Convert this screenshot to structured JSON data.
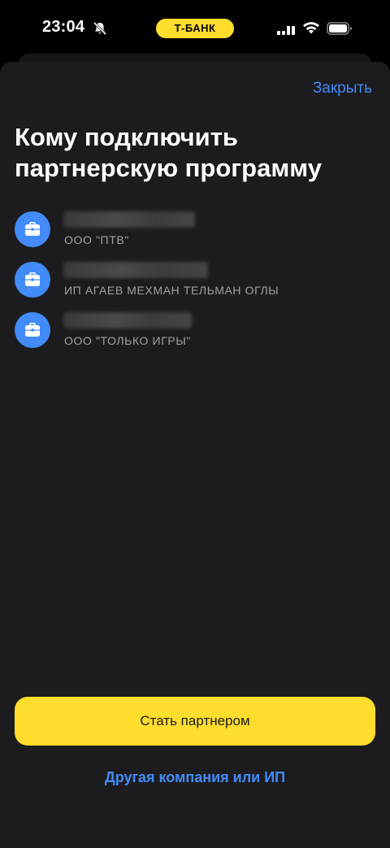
{
  "status_bar": {
    "time": "23:04",
    "pill_label": "Т-БАНК",
    "icons": [
      "bell-slash-icon",
      "cellular-signal-icon",
      "wifi-icon",
      "battery-icon"
    ]
  },
  "header": {
    "close_label": "Закрыть"
  },
  "title": "Кому подключить партнерскую программу",
  "accounts": [
    {
      "icon": "briefcase-icon",
      "name": "",
      "subtitle": "ООО \"ПТВ\""
    },
    {
      "icon": "briefcase-icon",
      "name": "",
      "subtitle": "ИП АГАЕВ МЕХМАН ТЕЛЬМАН ОГЛЫ"
    },
    {
      "icon": "briefcase-icon",
      "name": "",
      "subtitle": "ООО \"ТОЛЬКО ИГРЫ\""
    }
  ],
  "actions": {
    "primary_label": "Стать партнером",
    "secondary_label": "Другая компания или ИП"
  },
  "colors": {
    "accent_yellow": "#ffdd2d",
    "link_blue": "#428bf9",
    "sheet_background": "#1c1c1e"
  }
}
